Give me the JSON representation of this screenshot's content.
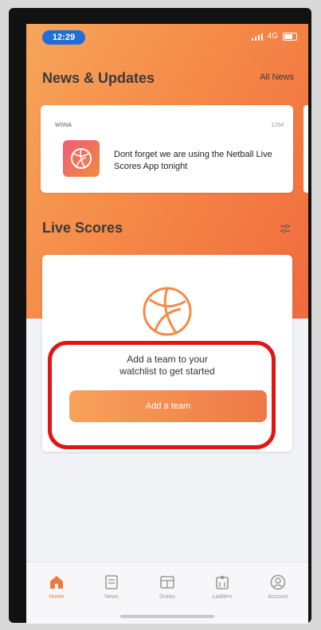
{
  "status_bar": {
    "time": "12:29",
    "network": "4G"
  },
  "news": {
    "title": "News & Updates",
    "all_news_label": "All News",
    "card": {
      "org": "WSNA",
      "age": "125d",
      "text": "Dont forget we are using the Netball Live Scores App tonight"
    }
  },
  "live_scores": {
    "title": "Live Scores",
    "empty_message_line1": "Add a team to your",
    "empty_message_line2": "watchlist to get started",
    "add_team_label": "Add a team"
  },
  "tabs": [
    {
      "label": "Home",
      "icon": "home-icon",
      "active": true
    },
    {
      "label": "News",
      "icon": "news-icon",
      "active": false
    },
    {
      "label": "Draws",
      "icon": "draws-icon",
      "active": false
    },
    {
      "label": "Ladders",
      "icon": "ladders-icon",
      "active": false
    },
    {
      "label": "Account",
      "icon": "account-icon",
      "active": false
    }
  ],
  "colors": {
    "accent": "#f07a3e",
    "gradient_start": "#f6a55a",
    "gradient_end": "#f06a3e",
    "highlight": "#e11515",
    "status_time_bg": "#1f6fd6"
  }
}
